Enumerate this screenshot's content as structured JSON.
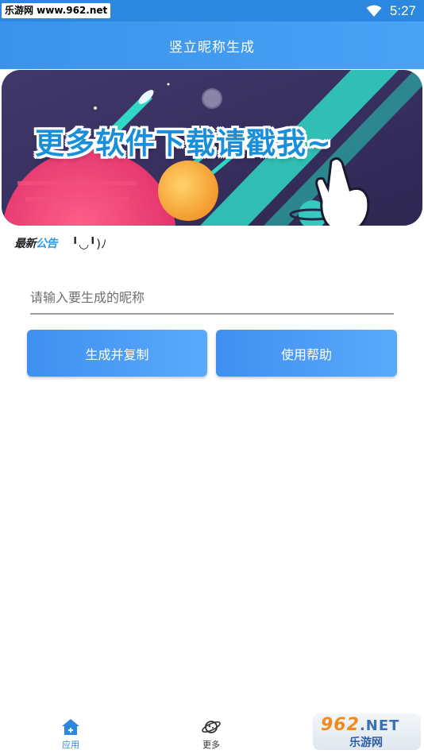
{
  "status_bar": {
    "watermark": "乐游网 www.962.net",
    "time": "5:27",
    "icons": [
      "wifi-icon"
    ]
  },
  "header": {
    "title": "竖立昵称生成"
  },
  "banner": {
    "text": "更多软件下载请戳我~"
  },
  "notice": {
    "badge_part1": "最新",
    "badge_part2": "公告",
    "text": "╹◡╹)ﾉ"
  },
  "input": {
    "value": "",
    "placeholder": "请输入要生成的昵称"
  },
  "buttons": {
    "generate": "生成并复制",
    "help": "使用帮助"
  },
  "bottom_nav": {
    "items": [
      {
        "label": "应用",
        "icon": "home-icon",
        "active": true
      },
      {
        "label": "更多",
        "icon": "planet-icon",
        "active": false
      }
    ]
  },
  "watermark_bottom": {
    "line1": "962",
    "line1_suffix": ".NET",
    "line2": "乐游网"
  },
  "colors": {
    "primary": "#2b87e0",
    "header": "#4aa2f5",
    "button": "#4a9cf6"
  }
}
